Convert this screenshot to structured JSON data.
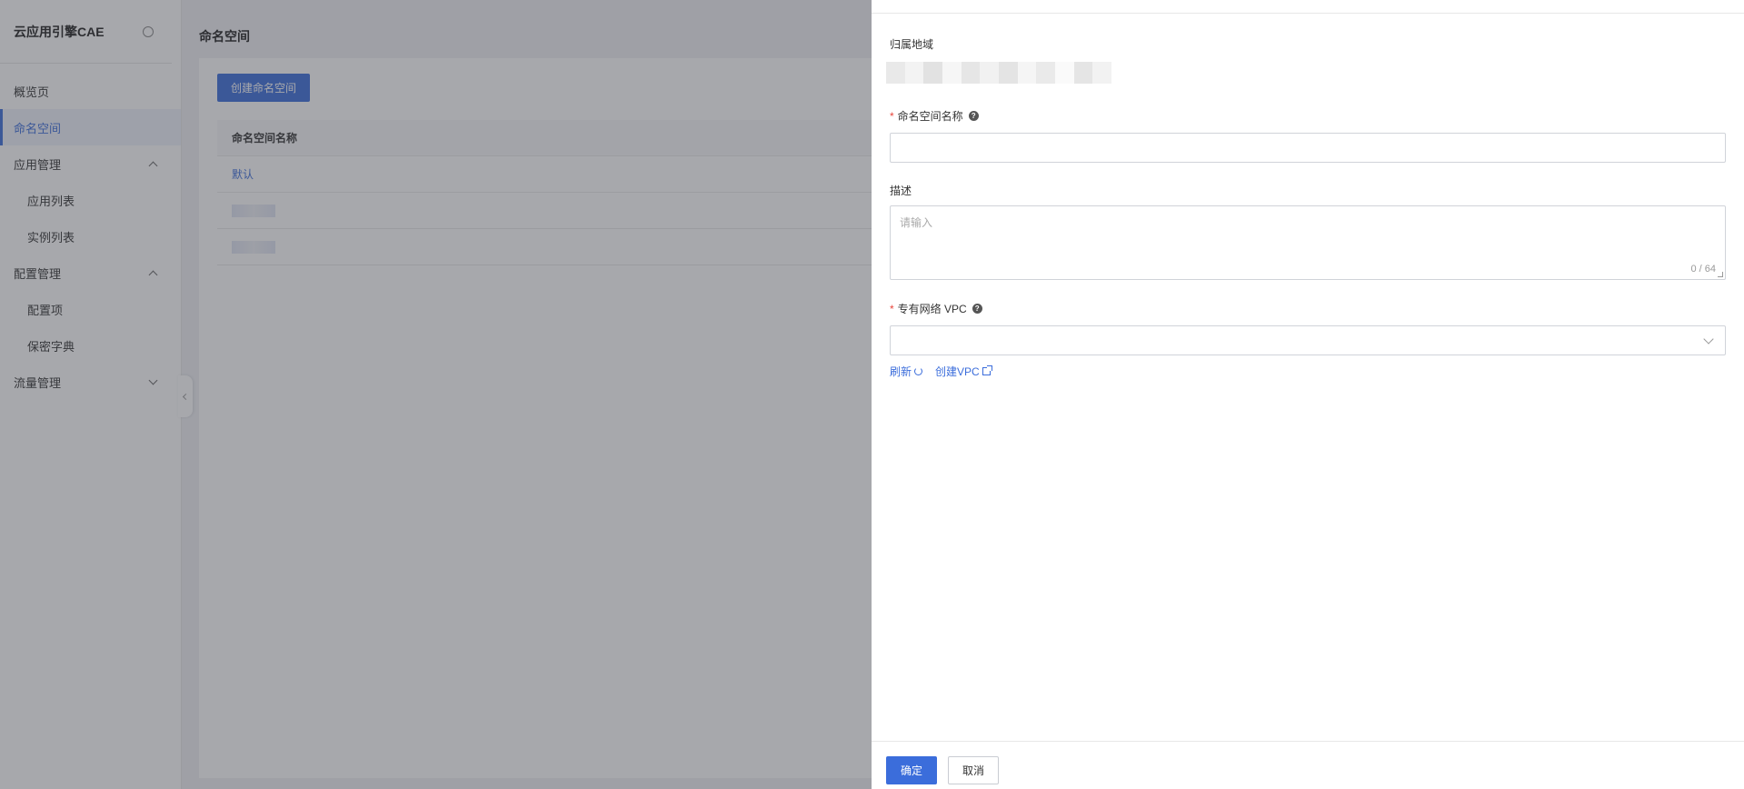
{
  "sidebar": {
    "title": "云应用引擎CAE",
    "items": [
      {
        "label": "概览页"
      },
      {
        "label": "命名空间"
      },
      {
        "label": "应用管理"
      },
      {
        "label": "应用列表"
      },
      {
        "label": "实例列表"
      },
      {
        "label": "配置管理"
      },
      {
        "label": "配置项"
      },
      {
        "label": "保密字典"
      },
      {
        "label": "流量管理"
      }
    ],
    "active_item": "命名空间"
  },
  "main": {
    "page_title": "命名空间",
    "create_button": "创建命名空间",
    "table": {
      "columns": [
        "命名空间名称"
      ],
      "rows": [
        {
          "name": "默认"
        }
      ]
    }
  },
  "drawer": {
    "region_label": "归属地域",
    "namespace_name_label": "命名空间名称",
    "namespace_name_value": "",
    "description_label": "描述",
    "description_placeholder": "请输入",
    "description_counter": "0 / 64",
    "vpc_label": "专有网络 VPC",
    "vpc_value": "",
    "refresh_link": "刷新",
    "create_vpc_link": "创建VPC",
    "confirm_button": "确定",
    "cancel_button": "取消"
  },
  "colors": {
    "primary": "#3b6ddb",
    "required": "#e9463c",
    "overlay": "rgba(60,62,70,0.45)"
  }
}
